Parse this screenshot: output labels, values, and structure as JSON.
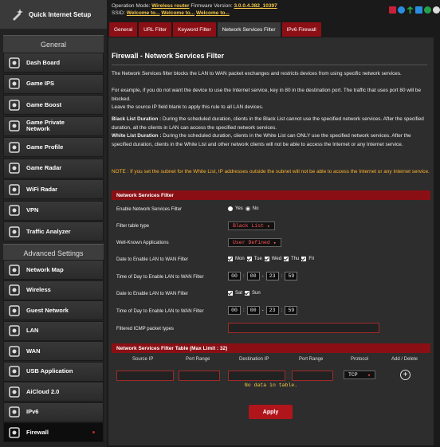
{
  "sidebar": {
    "quick_setup": "Quick Internet Setup",
    "general_header": "General",
    "advanced_header": "Advanced Settings",
    "general_items": [
      {
        "label": "Dash Board",
        "icon": "dashboard-icon"
      },
      {
        "label": "Game IPS",
        "icon": "shield-icon"
      },
      {
        "label": "Game Boost",
        "icon": "rocket-icon"
      },
      {
        "label": "Game Private\nNetwork",
        "icon": "private-network-icon"
      },
      {
        "label": "Game Profile",
        "icon": "game-profile-icon"
      },
      {
        "label": "Game Radar",
        "icon": "radar-icon"
      },
      {
        "label": "WiFi Radar",
        "icon": "wifi-radar-icon"
      },
      {
        "label": "VPN",
        "icon": "vpn-icon"
      },
      {
        "label": "Traffic Analyzer",
        "icon": "traffic-icon"
      }
    ],
    "advanced_items": [
      {
        "label": "Network Map",
        "icon": "network-map-icon"
      },
      {
        "label": "Wireless",
        "icon": "wireless-icon"
      },
      {
        "label": "Guest Network",
        "icon": "guest-network-icon"
      },
      {
        "label": "LAN",
        "icon": "lan-icon"
      },
      {
        "label": "WAN",
        "icon": "wan-icon"
      },
      {
        "label": "USB Application",
        "icon": "usb-icon"
      },
      {
        "label": "AiCloud 2.0",
        "icon": "cloud-icon"
      },
      {
        "label": "IPv6",
        "icon": "ipv6-icon"
      },
      {
        "label": "Firewall",
        "icon": "firewall-icon"
      }
    ]
  },
  "top": {
    "op_mode_label": "Operation Mode:",
    "op_mode_value": "Wireless router",
    "fw_label": "Firmware Version:",
    "fw_value": "3.0.0.4.382_10397",
    "ssid_label": "SSID:",
    "ssid_values": [
      "Welcome to...",
      "Welcome to...",
      "Welcome to..."
    ]
  },
  "tabs": [
    "General",
    "URL Filter",
    "Keyword Filter",
    "Network Services Filter",
    "IPv6 Firewall"
  ],
  "page": {
    "title": "Firewall - Network Services Filter",
    "desc1": "The Network Services filter blocks the LAN to WAN packet exchanges and restricts devices from using specific network services.",
    "desc2": "For example, if you do not want the device to use the Internet service, key in 80 in the destination port. The traffic that uses port 80 will be blocked.",
    "desc3": "Leave the source IP field blank to apply this rule to all LAN devices.",
    "black_label": "Black List Duration :",
    "black_text": "During the scheduled duration, clients in the Black List cannot use the specified network services. After the specified duration, all the clients in LAN can access the specified network services.",
    "white_label": "White List Duration :",
    "white_text": "During the scheduled duration, clients in the White List can ONLY use the specified network services. After the specified duration, clients in the White List and other network clients will not be able to access the Internet or any Internet service.",
    "note": "NOTE : If you set the subnet for the White List, IP addresses outside the subnet will not be able to access the Internet or any Internet service."
  },
  "filter": {
    "header": "Network Services Filter",
    "enable_label": "Enable Network Services Filter",
    "yes": "Yes",
    "no": "No",
    "table_type_label": "Filter table type",
    "table_type_value": "Black List",
    "apps_label": "Well-Known Applications",
    "apps_value": "User Defined",
    "date_label": "Date to Enable LAN to WAN Filter",
    "weekdays": [
      "Mon",
      "Tue",
      "Wed",
      "Thu",
      "Fri"
    ],
    "time_label": "Time of Day to Enable LAN to WAN Filter",
    "time_weekday": [
      "00",
      "00",
      "23",
      "59"
    ],
    "date2_label": "Date to Enable LAN to WAN Filter",
    "weekend": [
      "Sat",
      "Sun"
    ],
    "time2_label": "Time of Day to Enable LAN to WAN Filter",
    "time_weekend": [
      "00",
      "00",
      "23",
      "59"
    ],
    "icmp_label": "Filtered ICMP packet types"
  },
  "table": {
    "header": "Network Services Filter Table (Max Limit : 32)",
    "columns": [
      "Source IP",
      "Port Range",
      "Destination IP",
      "Port Range",
      "Protocol",
      "Add / Delete"
    ],
    "protocol_value": "TCP",
    "empty_text": "No data in table."
  },
  "apply_label": "Apply",
  "colors": {
    "accent": "#b0151c",
    "header": "#8a0f14",
    "link": "#f5c84a",
    "note": "#ffb32e"
  }
}
